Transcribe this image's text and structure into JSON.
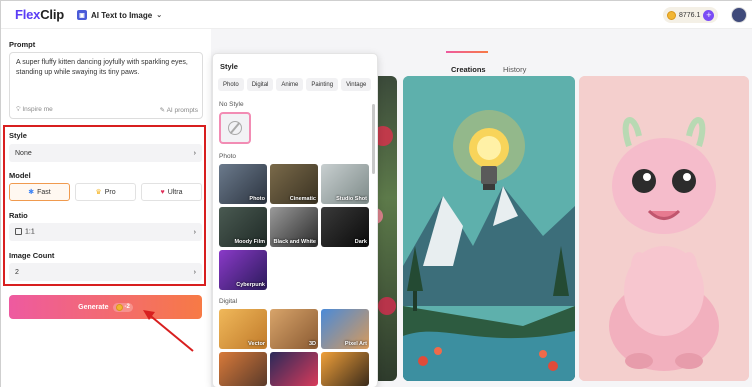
{
  "app": {
    "logo_main": "Flex",
    "logo_accent": "Clip"
  },
  "header": {
    "tool_label": "AI Text to Image",
    "credits": "8776.1"
  },
  "prompt": {
    "label": "Prompt",
    "text": "A super fluffy kitten dancing joyfully with sparkling eyes, standing up while swaying its tiny paws.",
    "inspire": "Inspire me",
    "ai_prompts": "AI prompts"
  },
  "style_field": {
    "label": "Style",
    "value": "None"
  },
  "model": {
    "label": "Model",
    "options": [
      "Fast",
      "Pro",
      "Ultra"
    ]
  },
  "ratio": {
    "label": "Ratio",
    "value": "1:1"
  },
  "image_count": {
    "label": "Image Count",
    "value": "2"
  },
  "generate": {
    "label": "Generate",
    "cost": "-2"
  },
  "style_popup": {
    "title": "Style",
    "chips": [
      "Photo",
      "Digital",
      "Anime",
      "Painting",
      "Vintage"
    ],
    "no_style_label": "No Style",
    "photo_section": "Photo",
    "photo_tiles": [
      "Photo",
      "Cinematic",
      "Studio Shot",
      "Moody Film",
      "Black and White",
      "Dark",
      "Cyberpunk"
    ],
    "digital_section": "Digital",
    "digital_tiles": [
      "Vector",
      "3D",
      "Pixel Art"
    ]
  },
  "tabs": {
    "creations": "Creations",
    "history": "History"
  },
  "colors": {
    "accent_purple": "#7a4cf5",
    "highlight_red": "#d81f1f",
    "generate_start": "#ee5aa0",
    "generate_end": "#f77a45"
  }
}
